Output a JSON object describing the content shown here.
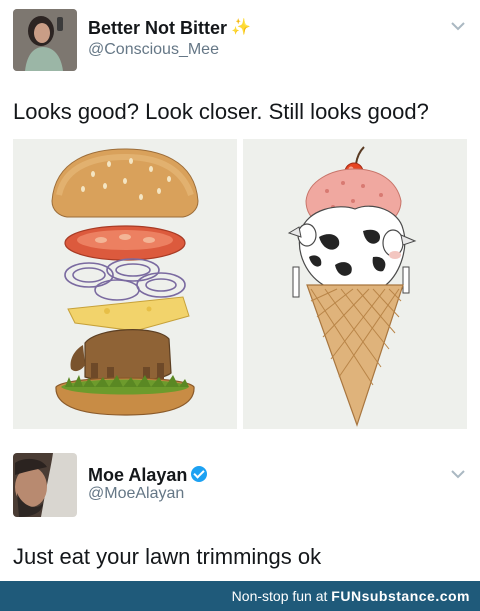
{
  "tweet1": {
    "display_name": "Better Not Bitter",
    "name_emoji": "✨",
    "handle": "@Conscious_Mee",
    "text": "Looks good? Look closer. Still looks good?"
  },
  "tweet2": {
    "display_name": "Moe Alayan",
    "handle": "@MoeAlayan",
    "text": "Just eat your lawn trimmings ok"
  },
  "footer": {
    "prefix": "Non-stop fun at ",
    "brand": "FUNsubstance.com"
  },
  "colors": {
    "handle": "#657786",
    "verified": "#1da1f2",
    "footer_bg": "#1f5a7a"
  },
  "icons": {
    "chevron": "chevron-down-icon",
    "verified": "verified-badge-icon"
  }
}
